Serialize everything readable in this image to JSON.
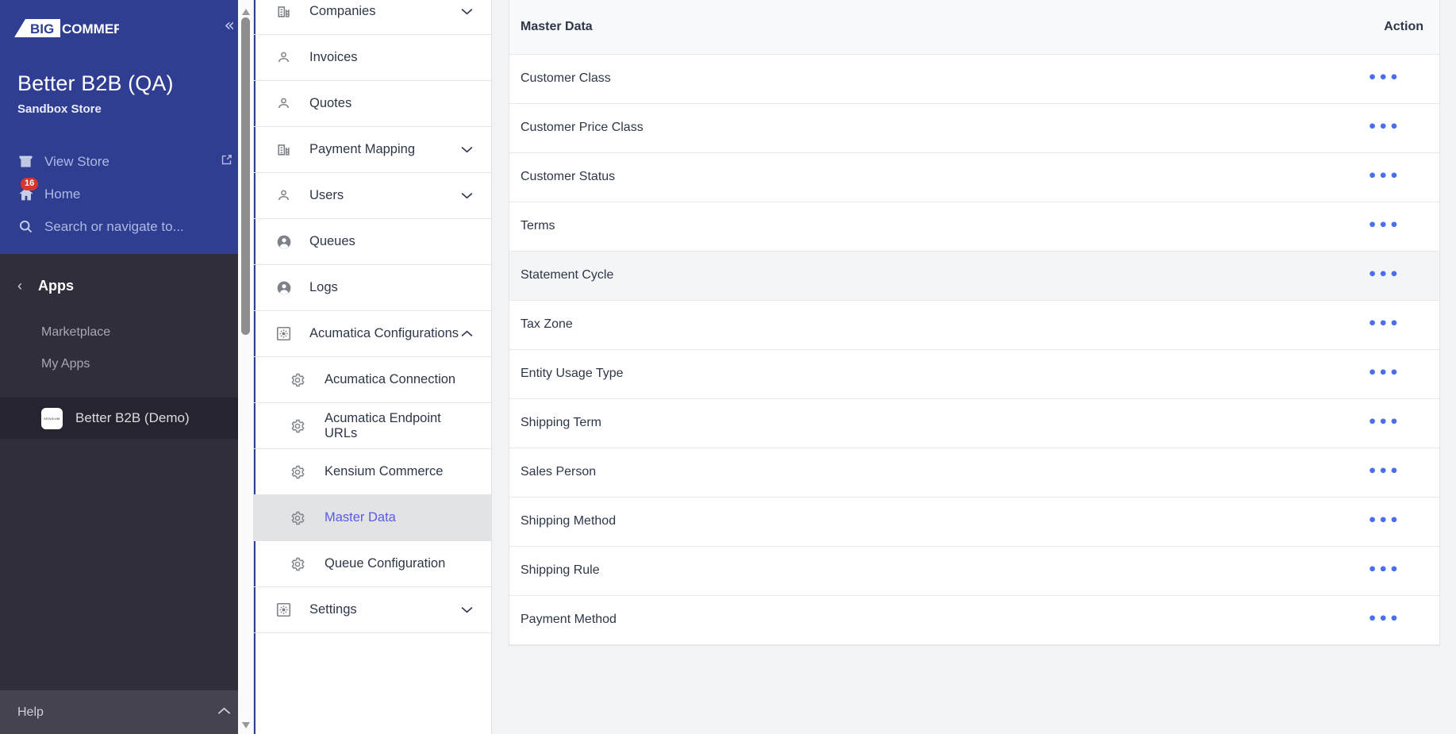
{
  "sidebar": {
    "brand": "BIGCOMMERCE",
    "collapse_icon": "chevron-double-left-icon",
    "store_name": "Better B2B (QA)",
    "store_subtitle": "Sandbox Store",
    "links": [
      {
        "label": "View Store",
        "icon": "storefront-icon",
        "trailing_icon": "external-link-icon"
      },
      {
        "label": "Home",
        "icon": "home-icon",
        "badge": "16"
      }
    ],
    "search_placeholder": "Search or navigate to...",
    "search_icon": "search-icon",
    "apps": {
      "back_icon": "chevron-left-icon",
      "title": "Apps",
      "items": [
        {
          "label": "Marketplace"
        },
        {
          "label": "My Apps"
        }
      ],
      "installed": [
        {
          "label": "Better B2B (Demo)",
          "thumb_text": "KENSIUM",
          "selected": true
        }
      ]
    },
    "help": {
      "label": "Help",
      "icon": "chevron-up-icon"
    }
  },
  "navpanel": {
    "items": [
      {
        "label": "Companies",
        "icon": "building-icon",
        "chevron": "chevron-down-icon",
        "level": 0
      },
      {
        "label": "Invoices",
        "icon": "person-icon",
        "chevron": "",
        "level": 0
      },
      {
        "label": "Quotes",
        "icon": "person-icon",
        "chevron": "",
        "level": 0
      },
      {
        "label": "Payment Mapping",
        "icon": "building-icon",
        "chevron": "chevron-down-icon",
        "level": 0
      },
      {
        "label": "Users",
        "icon": "person-icon",
        "chevron": "chevron-down-icon",
        "level": 0
      },
      {
        "label": "Queues",
        "icon": "account-circle-icon",
        "chevron": "",
        "level": 0
      },
      {
        "label": "Logs",
        "icon": "account-circle-icon",
        "chevron": "",
        "level": 0
      },
      {
        "label": "Acumatica Configurations",
        "icon": "settings-box-icon",
        "chevron": "chevron-up-icon",
        "level": 0
      },
      {
        "label": "Acumatica Connection",
        "icon": "gear-icon",
        "chevron": "",
        "level": 1
      },
      {
        "label": "Acumatica Endpoint URLs",
        "icon": "gear-icon",
        "chevron": "",
        "level": 1
      },
      {
        "label": "Kensium Commerce",
        "icon": "gear-icon",
        "chevron": "",
        "level": 1
      },
      {
        "label": "Master Data",
        "icon": "gear-icon",
        "chevron": "",
        "level": 1,
        "selected": true
      },
      {
        "label": "Queue Configuration",
        "icon": "gear-icon",
        "chevron": "",
        "level": 1
      },
      {
        "label": "Settings",
        "icon": "settings-box-icon",
        "chevron": "chevron-down-icon",
        "level": 0
      }
    ],
    "scrollbar": {
      "up_icon": "scroll-up-arrow-icon",
      "down_icon": "scroll-down-arrow-icon"
    }
  },
  "table": {
    "columns": [
      "Master Data",
      "Action"
    ],
    "action_icon": "ellipsis-icon",
    "rows": [
      {
        "name": "Customer Class",
        "hover": false
      },
      {
        "name": "Customer Price Class",
        "hover": false
      },
      {
        "name": "Customer Status",
        "hover": false
      },
      {
        "name": "Terms",
        "hover": false
      },
      {
        "name": "Statement Cycle",
        "hover": true
      },
      {
        "name": "Tax Zone",
        "hover": false
      },
      {
        "name": "Entity Usage Type",
        "hover": false
      },
      {
        "name": "Shipping Term",
        "hover": false
      },
      {
        "name": "Sales Person",
        "hover": false
      },
      {
        "name": "Shipping Method",
        "hover": false
      },
      {
        "name": "Shipping Rule",
        "hover": false
      },
      {
        "name": "Payment Method",
        "hover": false
      }
    ]
  },
  "colors": {
    "brand_blue": "#2f3e91",
    "sidebar_dark": "#312e3c",
    "selected_nav_text": "#5a5ae6",
    "action_dots": "#4a6ef0",
    "badge_red": "#d9352c",
    "page_bg": "#f1f3f5"
  }
}
